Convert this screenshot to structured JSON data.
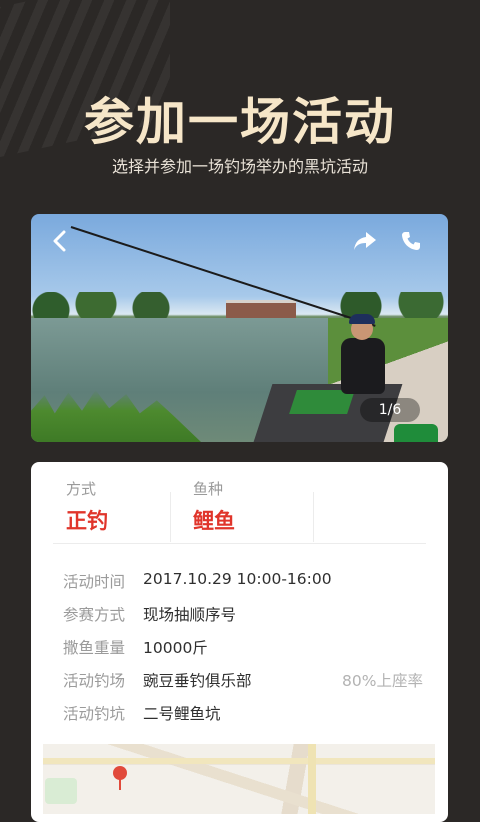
{
  "hero": {
    "title": "参加一场活动",
    "subtitle": "选择并参加一场钓场举办的黑坑活动"
  },
  "photo": {
    "counter": "1/6",
    "icons": {
      "back": "chevron-left-icon",
      "share": "share-icon",
      "phone": "phone-icon"
    }
  },
  "card": {
    "stats": [
      {
        "label": "方式",
        "value": "正钓"
      },
      {
        "label": "鱼种",
        "value": "鲤鱼"
      }
    ],
    "details": [
      {
        "key": "活动时间",
        "value": "2017.10.29  10:00-16:00"
      },
      {
        "key": "参赛方式",
        "value": "现场抽顺序号"
      },
      {
        "key": "撒鱼重量",
        "value": "10000斤"
      },
      {
        "key": "活动钓场",
        "value": "豌豆垂钓俱乐部",
        "extra": "80%上座率"
      },
      {
        "key": "活动钓坑",
        "value": "二号鲤鱼坑"
      }
    ]
  },
  "colors": {
    "background": "#2b2826",
    "hero_title": "#f6e6c8",
    "accent_red": "#e0352b"
  }
}
